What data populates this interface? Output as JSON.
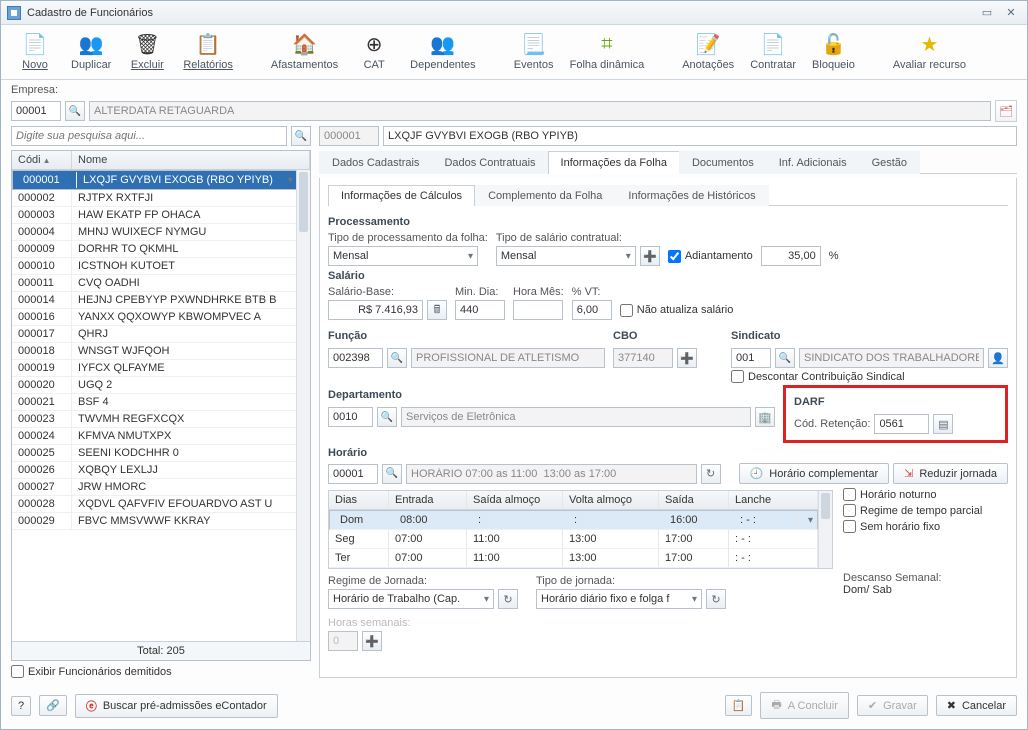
{
  "window": {
    "title": "Cadastro de Funcionários"
  },
  "toolbar": {
    "novo": "Novo",
    "duplicar": "Duplicar",
    "excluir": "Excluir",
    "relatorios": "Relatórios",
    "afastamentos": "Afastamentos",
    "cat": "CAT",
    "dependentes": "Dependentes",
    "eventos": "Eventos",
    "folha": "Folha dinâmica",
    "anotacoes": "Anotações",
    "contratar": "Contratar",
    "bloqueio": "Bloqueio",
    "avaliar": "Avaliar recurso"
  },
  "empresa": {
    "label": "Empresa:",
    "code": "00001",
    "name": "ALTERDATA RETAGUARDA"
  },
  "search": {
    "placeholder": "Digite sua pesquisa aqui..."
  },
  "selected": {
    "code": "000001",
    "name": "LXQJF GVYBVI EXOGB (RBO YPIYB)"
  },
  "grid": {
    "col_code": "Códi",
    "col_name": "Nome",
    "total_label": "Total: 205",
    "rows": [
      {
        "c": "000001",
        "n": "LXQJF GVYBVI EXOGB (RBO YPIYB)"
      },
      {
        "c": "000002",
        "n": "RJTPX RXTFJI"
      },
      {
        "c": "000003",
        "n": "HAW EKATP FP OHACA"
      },
      {
        "c": "000004",
        "n": "MHNJ WUIXECF NYMGU"
      },
      {
        "c": "000009",
        "n": "DORHR TO QKMHL"
      },
      {
        "c": "000010",
        "n": "ICSTNOH KUTOET"
      },
      {
        "c": "000011",
        "n": "CVQ OADHI"
      },
      {
        "c": "000014",
        "n": "HEJNJ CPEBYYP PXWNDHRKE BTB B"
      },
      {
        "c": "000016",
        "n": "YANXX QQXOWYP KBWOMPVEC A"
      },
      {
        "c": "000017",
        "n": "QHRJ"
      },
      {
        "c": "000018",
        "n": "WNSGT WJFQOH"
      },
      {
        "c": "000019",
        "n": "IYFCX QLFAYME"
      },
      {
        "c": "000020",
        "n": "UGQ 2"
      },
      {
        "c": "000021",
        "n": "BSF 4"
      },
      {
        "c": "000023",
        "n": "TWVMH REGFXCQX"
      },
      {
        "c": "000024",
        "n": "KFMVA NMUTXPX"
      },
      {
        "c": "000025",
        "n": "SEENI KODCHHR 0"
      },
      {
        "c": "000026",
        "n": "XQBQY LEXLJJ"
      },
      {
        "c": "000027",
        "n": "JRW HMORC"
      },
      {
        "c": "000028",
        "n": "XQDVL QAFVFIV EFOUARDVO AST U"
      },
      {
        "c": "000029",
        "n": "FBVC MMSVWWF KKRAY"
      }
    ]
  },
  "exibir_demitidos": "Exibir Funcionários demitidos",
  "tabs": {
    "cadastrais": "Dados Cadastrais",
    "contratuais": "Dados Contratuais",
    "folha": "Informações da Folha",
    "documentos": "Documentos",
    "adicionais": "Inf. Adicionais",
    "gestao": "Gestão"
  },
  "subtabs": {
    "calculos": "Informações de Cálculos",
    "complemento": "Complemento da Folha",
    "historicos": "Informações de  Históricos"
  },
  "proc": {
    "title": "Processamento",
    "tipo_proc_lbl": "Tipo de processamento da folha:",
    "tipo_proc_val": "Mensal",
    "tipo_sal_lbl": "Tipo de salário contratual:",
    "tipo_sal_val": "Mensal",
    "adiant": "Adiantamento",
    "adiant_val": "35,00",
    "pct": "%"
  },
  "salario": {
    "title": "Salário",
    "base_lbl": "Salário-Base:",
    "base_val": "R$ 7.416,93",
    "min_lbl": "Min. Dia:",
    "min_val": "440",
    "hora_lbl": "Hora Mês:",
    "hora_val": "",
    "vt_lbl": "% VT:",
    "vt_val": "6,00",
    "nao_atualiza": "Não atualiza salário"
  },
  "funcao": {
    "title": "Função",
    "code": "002398",
    "desc": "PROFISSIONAL DE ATLETISMO"
  },
  "cbo": {
    "title": "CBO",
    "code": "377140"
  },
  "sindicato": {
    "title": "Sindicato",
    "code": "001",
    "desc": "SINDICATO DOS TRABALHADORES DE",
    "descontar": "Descontar Contribuição Sindical"
  },
  "departamento": {
    "title": "Departamento",
    "code": "0010",
    "desc": "Serviços de Eletrônica"
  },
  "darf": {
    "title": "DARF",
    "cod_lbl": "Cód. Retenção:",
    "cod_val": "0561"
  },
  "horario": {
    "title": "Horário",
    "code": "00001",
    "desc": "HORÁRIO 07:00 as 11:00  13:00 as 17:00",
    "complementar": "Horário complementar",
    "reduzir": "Reduzir jornada",
    "noturno": "Horário noturno",
    "parcial": "Regime de tempo parcial",
    "fixo": "Sem horário fixo",
    "cols": {
      "dias": "Dias",
      "entrada": "Entrada",
      "saida_alm": "Saída almoço",
      "volta_alm": "Volta almoço",
      "saida": "Saída",
      "lanche": "Lanche"
    },
    "rows": [
      {
        "d": "Dom",
        "e": "08:00",
        "sa": ":",
        "va": ":",
        "s": "16:00",
        "l": ":  -  :"
      },
      {
        "d": "Seg",
        "e": "07:00",
        "sa": "11:00",
        "va": "13:00",
        "s": "17:00",
        "l": ":  -  :"
      },
      {
        "d": "Ter",
        "e": "07:00",
        "sa": "11:00",
        "va": "13:00",
        "s": "17:00",
        "l": ":  -  :"
      }
    ]
  },
  "regime": {
    "jornada_lbl": "Regime de Jornada:",
    "jornada_val": "Horário de Trabalho (Cap.",
    "tipo_lbl": "Tipo de jornada:",
    "tipo_val": "Horário diário fixo e folga f",
    "horas_lbl": "Horas semanais:",
    "horas_val": "0",
    "descanso_lbl": "Descanso Semanal:",
    "descanso_val": "Dom/ Sab"
  },
  "footer": {
    "buscar": "Buscar pré-admissões eContador",
    "concluir": "A Concluir",
    "gravar": "Gravar",
    "cancelar": "Cancelar"
  }
}
